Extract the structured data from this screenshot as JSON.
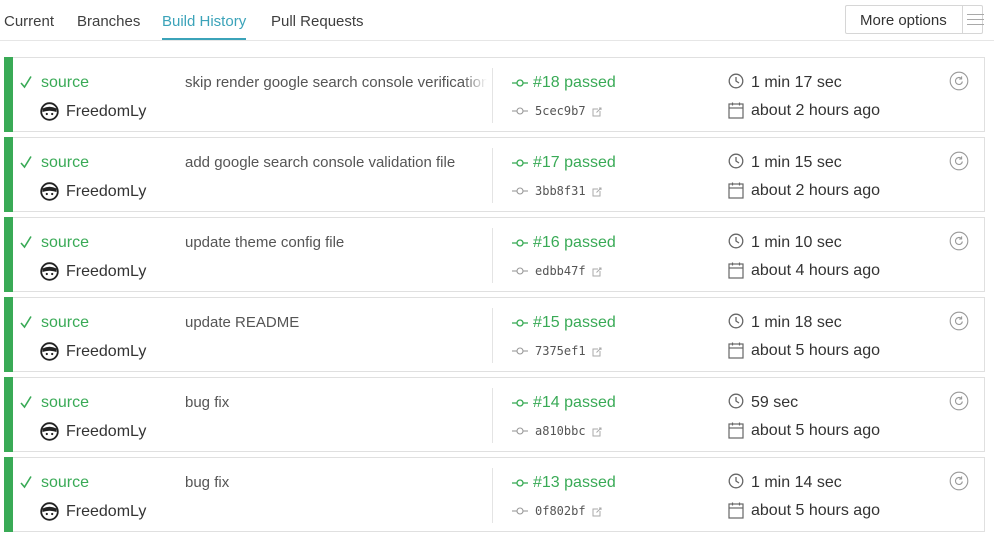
{
  "tabs": [
    {
      "label": "Current"
    },
    {
      "label": "Branches"
    },
    {
      "label": "Build History",
      "active": true
    },
    {
      "label": "Pull Requests"
    }
  ],
  "more_options": {
    "label": "More options",
    "icon": "hamburger-menu-icon"
  },
  "colors": {
    "passed": "#39aa56",
    "active_tab": "#3ba3b9"
  },
  "builds": [
    {
      "branch": "source",
      "author": "FreedomLy",
      "message": "skip render google search console verification file",
      "number": "#18 passed",
      "commit": "5cec9b7",
      "duration": "1 min 17 sec",
      "finished": "about 2 hours ago"
    },
    {
      "branch": "source",
      "author": "FreedomLy",
      "message": "add google search console validation file",
      "number": "#17 passed",
      "commit": "3bb8f31",
      "duration": "1 min 15 sec",
      "finished": "about 2 hours ago"
    },
    {
      "branch": "source",
      "author": "FreedomLy",
      "message": "update theme config file",
      "number": "#16 passed",
      "commit": "edbb47f",
      "duration": "1 min 10 sec",
      "finished": "about 4 hours ago"
    },
    {
      "branch": "source",
      "author": "FreedomLy",
      "message": "update README",
      "number": "#15 passed",
      "commit": "7375ef1",
      "duration": "1 min 18 sec",
      "finished": "about 5 hours ago"
    },
    {
      "branch": "source",
      "author": "FreedomLy",
      "message": "bug fix",
      "number": "#14 passed",
      "commit": "a810bbc",
      "duration": "59 sec",
      "finished": "about 5 hours ago"
    },
    {
      "branch": "source",
      "author": "FreedomLy",
      "message": "bug fix",
      "number": "#13 passed",
      "commit": "0f802bf",
      "duration": "1 min 14 sec",
      "finished": "about 5 hours ago"
    }
  ]
}
